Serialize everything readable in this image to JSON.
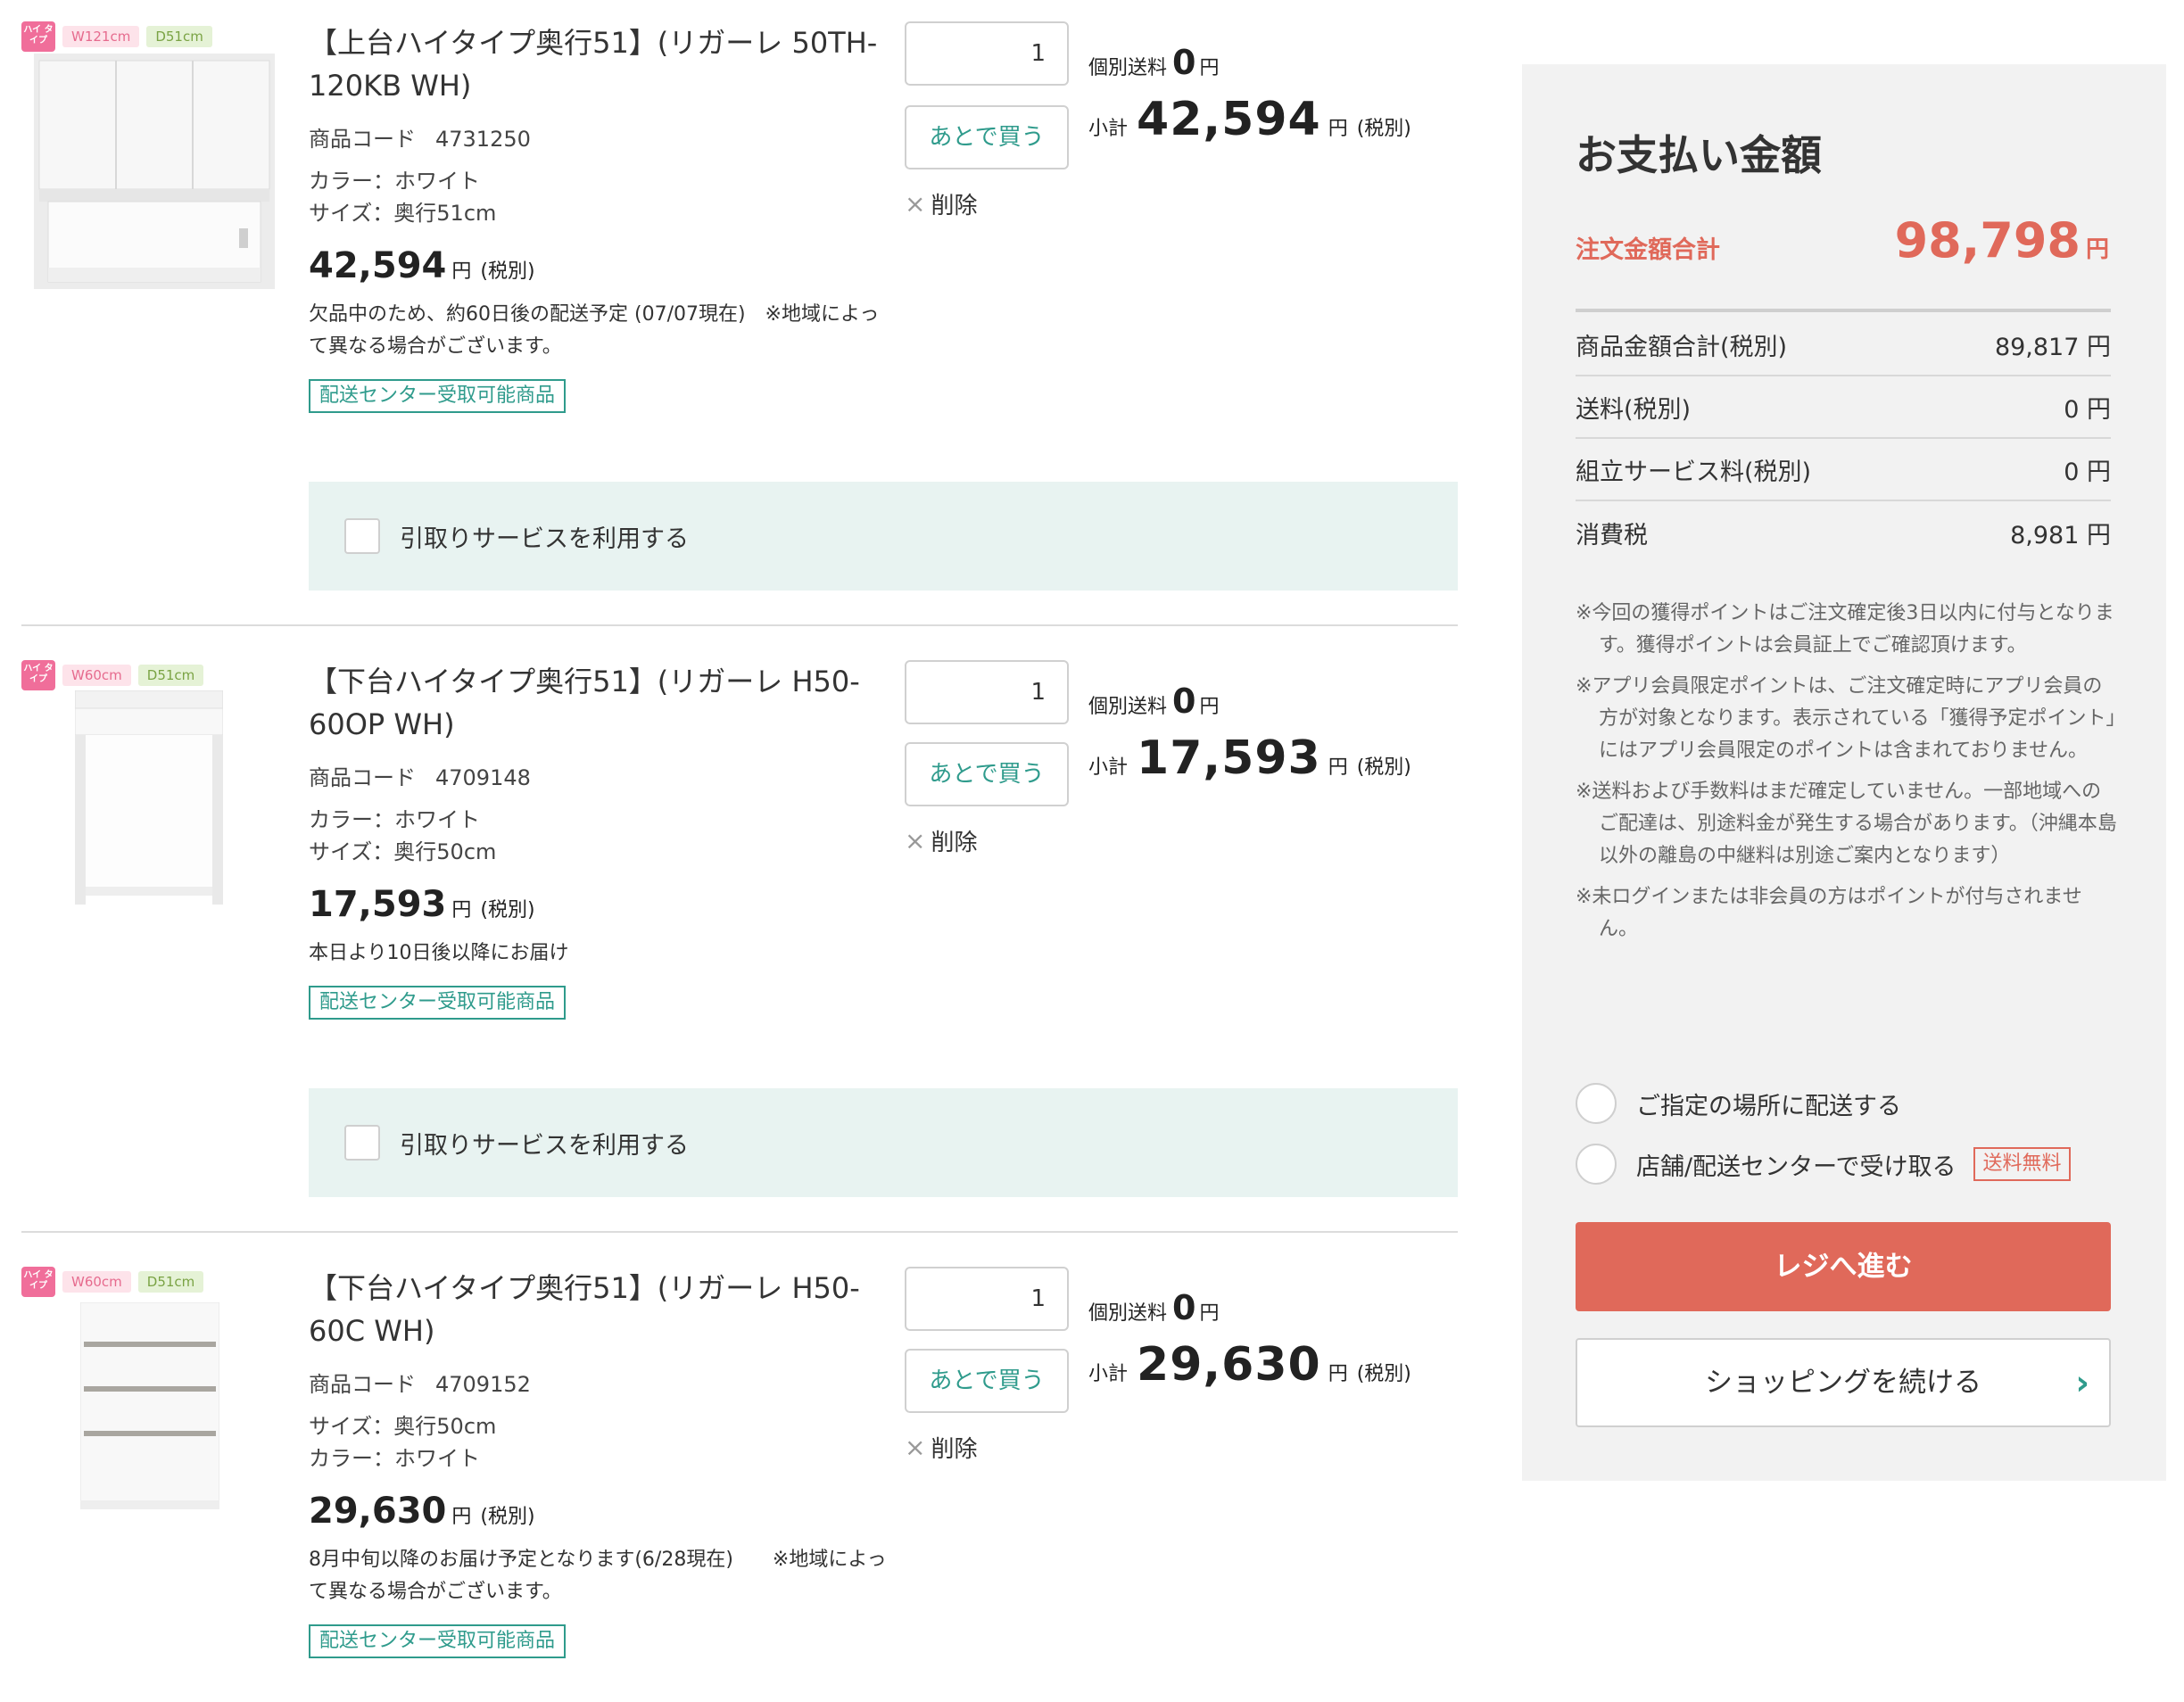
{
  "items": [
    {
      "tag_type": "ハイ タイプ",
      "tag_width": "W121cm",
      "tag_depth": "D51cm",
      "name": "【上台ハイタイプ奥行51】(リガーレ 50TH-120KB WH)",
      "code_label": "商品コード",
      "code": "4731250",
      "spec1": "カラー：ホワイト",
      "spec2": "サイズ：奥行51cm",
      "price": "42,594",
      "yen": "円",
      "tax": "(税別)",
      "note": "欠品中のため、約60日後の配送予定 (07/07現在)　※地域によって異なる場合がございます。",
      "pickup": "配送センター受取可能商品",
      "qty": "1",
      "later": "あとで買う",
      "delete": "削除",
      "ship_label": "個別送料",
      "ship_value": "0",
      "sub_label": "小計",
      "subtotal": "42,594",
      "service": "引取りサービスを利用する"
    },
    {
      "tag_type": "ハイ タイプ",
      "tag_width": "W60cm",
      "tag_depth": "D51cm",
      "name": "【下台ハイタイプ奥行51】(リガーレ H50-60OP WH)",
      "code_label": "商品コード",
      "code": "4709148",
      "spec1": "カラー：ホワイト",
      "spec2": "サイズ：奥行50cm",
      "price": "17,593",
      "yen": "円",
      "tax": "(税別)",
      "note": "本日より10日後以降にお届け",
      "pickup": "配送センター受取可能商品",
      "qty": "1",
      "later": "あとで買う",
      "delete": "削除",
      "ship_label": "個別送料",
      "ship_value": "0",
      "sub_label": "小計",
      "subtotal": "17,593",
      "service": "引取りサービスを利用する"
    },
    {
      "tag_type": "ハイ タイプ",
      "tag_width": "W60cm",
      "tag_depth": "D51cm",
      "name": "【下台ハイタイプ奥行51】(リガーレ H50-60C WH)",
      "code_label": "商品コード",
      "code": "4709152",
      "spec1": "サイズ：奥行50cm",
      "spec2": "カラー：ホワイト",
      "price": "29,630",
      "yen": "円",
      "tax": "(税別)",
      "note": "8月中旬以降のお届け予定となります(6/28現在)　　※地域によって異なる場合がございます。",
      "pickup": "配送センター受取可能商品",
      "qty": "1",
      "later": "あとで買う",
      "delete": "削除",
      "ship_label": "個別送料",
      "ship_value": "0",
      "sub_label": "小計",
      "subtotal": "29,630"
    }
  ],
  "summary": {
    "title": "お支払い金額",
    "total_label": "注文金額合計",
    "total": "98,798",
    "yen": "円",
    "rows": [
      {
        "label": "商品金額合計(税別)",
        "value": "89,817 円"
      },
      {
        "label": "送料(税別)",
        "value": "0 円"
      },
      {
        "label": "組立サービス料(税別)",
        "value": "0 円"
      },
      {
        "label": "消費税",
        "value": "8,981 円"
      }
    ],
    "notes": [
      "※今回の獲得ポイントはご注文確定後3日以内に付与となります。獲得ポイントは会員証上でご確認頂けます。",
      "※アプリ会員限定ポイントは、ご注文確定時にアプリ会員の方が対象となります。表示されている「獲得予定ポイント」にはアプリ会員限定のポイントは含まれておりません。",
      "※送料および手数料はまだ確定していません。一部地域へのご配達は、別途料金が発生する場合があります。（沖縄本島以外の離島の中継料は別途ご案内となります）",
      "※未ログインまたは非会員の方はポイントが付与されません。"
    ],
    "delivery_option": "ご指定の場所に配送する",
    "pickup_option": "店舗/配送センターで受け取る",
    "free_tag": "送料無料",
    "checkout": "レジへ進む",
    "continue": "ショッピングを続ける",
    "continue_icon": "chevron-right-icon"
  },
  "colors": {
    "accent_red": "#e0695a",
    "accent_teal": "#2f9b8c",
    "service_bg": "#e8f3f1",
    "summary_bg": "#f2f2f2"
  }
}
